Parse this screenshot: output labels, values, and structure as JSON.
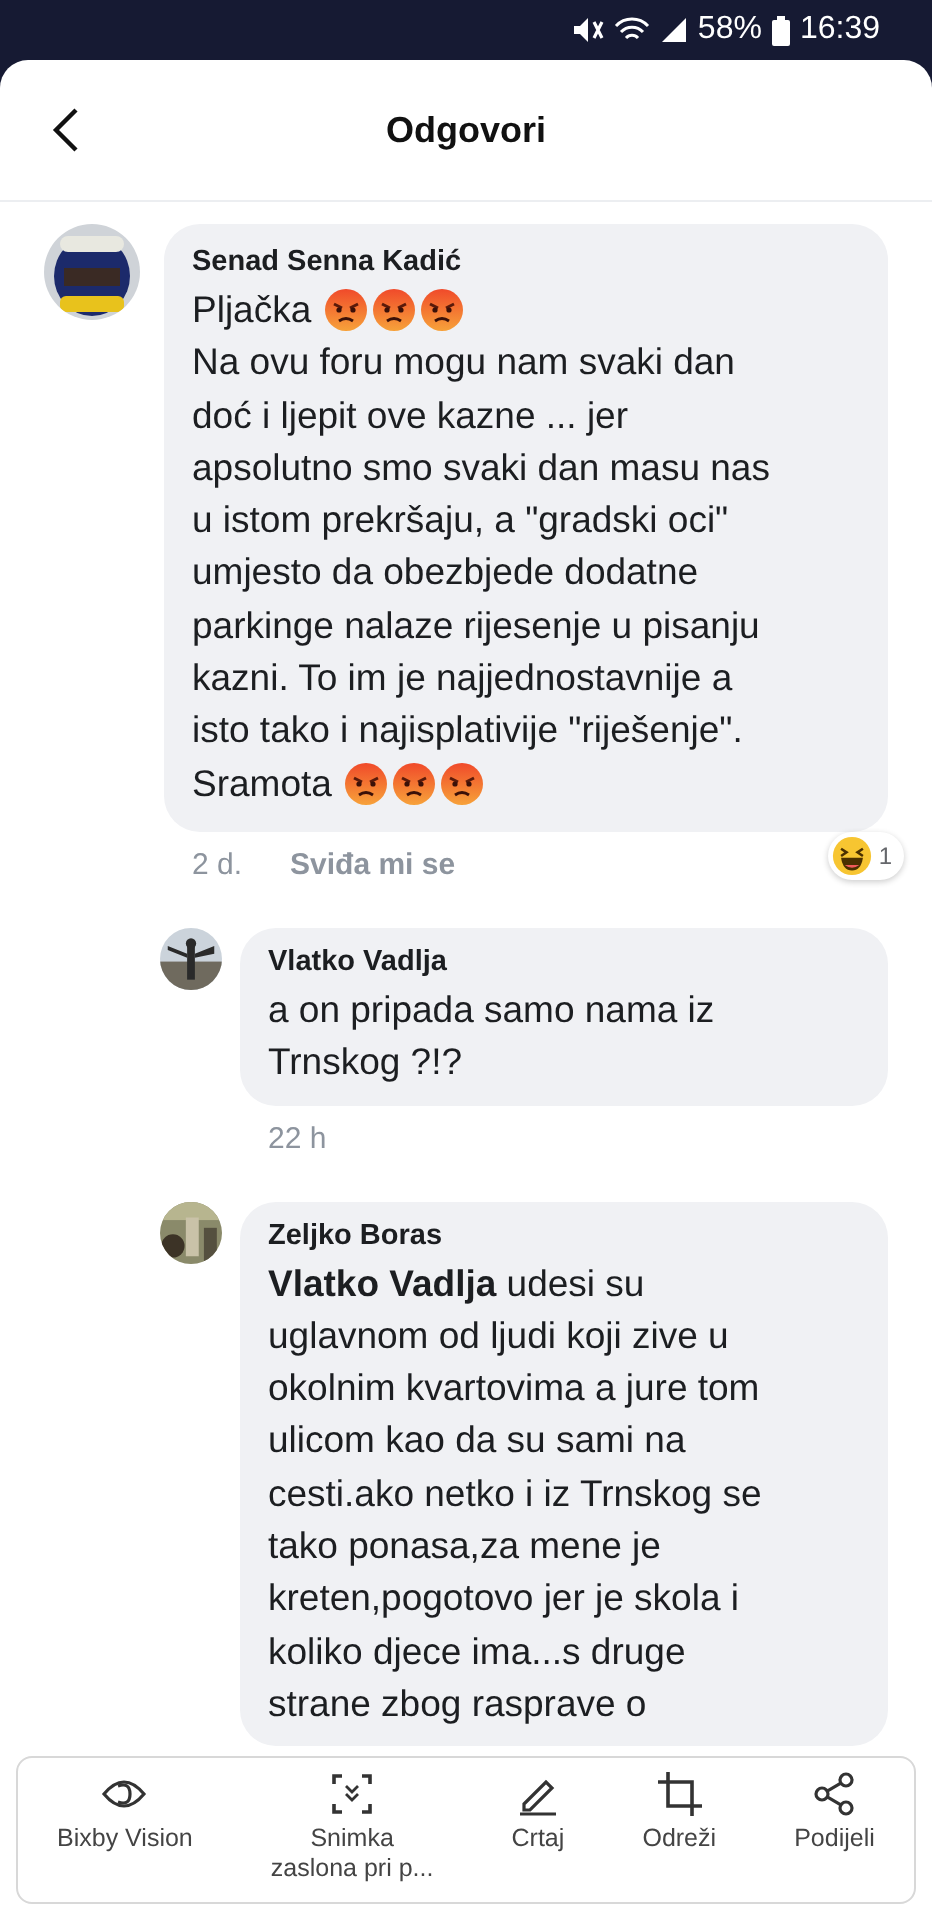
{
  "status_bar": {
    "battery": "58%",
    "time": "16:39"
  },
  "header": {
    "title": "Odgovori"
  },
  "comment": {
    "author": "Senad Senna Kadić",
    "time": "2 d.",
    "like_label": "Sviđa mi se",
    "reaction": {
      "kind": "haha",
      "count": "1"
    },
    "paragraphs": [
      {
        "lines": [
          "Pljačka"
        ],
        "emojis": [
          {
            "kind": "angry"
          },
          {
            "kind": "angry"
          },
          {
            "kind": "angry"
          }
        ]
      },
      {
        "lines": [
          "Na ovu foru mogu nam svaki dan",
          "doć i ljepit ove kazne ... jer",
          "apsolutno smo svaki dan masu nas",
          "u istom prekršaju, a \"gradski oci\"",
          "umjesto da obezbjede dodatne",
          "parkinge nalaze rijesenje u pisanju",
          "kazni. To im je najjednostavnije a",
          "isto tako i najisplativije \"riješenje\"."
        ]
      },
      {
        "lines": [
          "Sramota"
        ],
        "emojis": [
          {
            "kind": "angry"
          },
          {
            "kind": "angry"
          },
          {
            "kind": "angry"
          }
        ]
      }
    ]
  },
  "replies": [
    {
      "author": "Vlatko Vadlja",
      "time": "22 h",
      "lines": [
        "a on pripada samo nama iz",
        "Trnskog ?!?"
      ]
    },
    {
      "author": "Zeljko Boras",
      "lines": [
        "**Vlatko Vadlja** udesi su",
        "uglavnom od ljudi koji zive u",
        "okolnim kvartovima a jure tom",
        "ulicom kao da su sami na",
        "cesti.ako netko i iz Trnskog se",
        "tako ponasa,za mene je",
        "kreten,pogotovo jer je skola i",
        "koliko djece ima...s druge",
        "strane zbog rasprave o"
      ]
    }
  ],
  "toolbar": [
    {
      "kind": "eye",
      "label": "Bixby Vision"
    },
    {
      "kind": "capture",
      "label": "Snimka\nzaslona pri p..."
    },
    {
      "kind": "pen",
      "label": "Crtaj"
    },
    {
      "kind": "crop",
      "label": "Odreži"
    },
    {
      "kind": "share",
      "label": "Podijeli"
    }
  ]
}
